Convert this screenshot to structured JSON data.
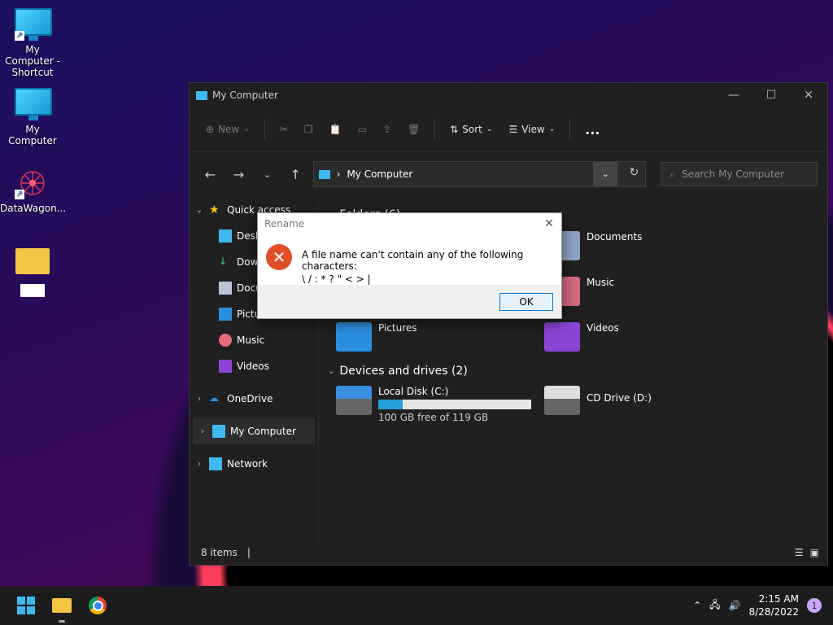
{
  "desktop": {
    "icons": [
      {
        "label": "My Computer - Shortcut"
      },
      {
        "label": "My Computer"
      },
      {
        "label": "DataWagon..."
      },
      {
        "label": ""
      }
    ]
  },
  "window": {
    "title": "My Computer",
    "toolbar": {
      "new_label": "New",
      "sort_label": "Sort",
      "view_label": "View",
      "more_label": "..."
    },
    "address": {
      "path_label": "My Computer"
    },
    "search": {
      "placeholder": "Search My Computer"
    },
    "sidebar": {
      "quick_access": "Quick access",
      "items": [
        "Desktop",
        "Downloads",
        "Documents",
        "Pictures",
        "Music",
        "Videos"
      ],
      "onedrive": "OneDrive",
      "my_computer": "My Computer",
      "network": "Network"
    },
    "main": {
      "folders_header": "Folders (6)",
      "folders": [
        "Documents",
        "Music",
        "Pictures",
        "Videos"
      ],
      "devices_header": "Devices and drives (2)",
      "drives": [
        {
          "name": "Local Disk (C:)",
          "free_text": "100 GB free of 119 GB",
          "used_fraction": 0.16
        },
        {
          "name": "CD Drive (D:)"
        }
      ]
    },
    "status": {
      "items_count": "8 items"
    }
  },
  "dialog": {
    "title": "Rename",
    "message_line1": "A file name can't contain any of the following characters:",
    "message_line2": "\\ / : * ? \" < > |",
    "ok_label": "OK"
  },
  "taskbar": {
    "time": "2:15 AM",
    "date": "8/28/2022",
    "notification_count": "1"
  }
}
